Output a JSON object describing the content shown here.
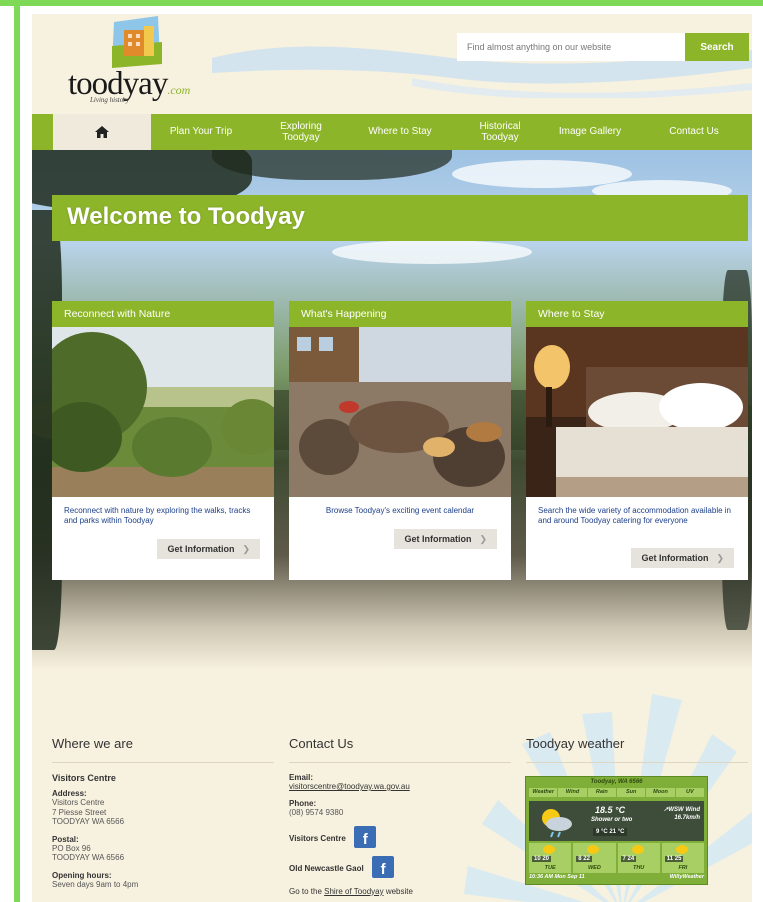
{
  "colors": {
    "brand_green": "#8db52a",
    "page_background": "#f7f1df",
    "frame_green": "#7ed957",
    "card_link_blue": "#1c3f8a",
    "facebook_blue": "#3b6db5"
  },
  "header": {
    "logo_text": "toodyay",
    "logo_suffix": ".com",
    "logo_tagline": "Living history",
    "search_placeholder": "Find almost anything on our website",
    "search_button": "Search"
  },
  "nav": {
    "home_icon": "home-icon",
    "items": [
      {
        "label": "Plan Your Trip"
      },
      {
        "label": "Exploring Toodyay"
      },
      {
        "label": "Where to Stay"
      },
      {
        "label": "Historical Toodyay"
      },
      {
        "label": "Image Gallery"
      },
      {
        "label": "Contact Us"
      }
    ]
  },
  "hero": {
    "title": "Welcome to Toodyay"
  },
  "cards": [
    {
      "title": "Reconnect with Nature",
      "text": "Reconnect with nature by exploring the walks, tracks and parks within Toodyay",
      "button": "Get Information"
    },
    {
      "title": "What's Happening",
      "text": "Browse Toodyay's exciting event calendar",
      "button": "Get Information"
    },
    {
      "title": "Where to Stay",
      "text": "Search the wide variety of accommodation available in and around Toodyay catering for everyone",
      "button": "Get Information"
    }
  ],
  "footer": {
    "where": {
      "heading": "Where we are",
      "centre_name": "Visitors Centre",
      "address_label": "Address:",
      "address_line1": "Visitors Centre",
      "address_line2": "7 Piesse Street",
      "address_line3": "TOODYAY  WA  6566",
      "postal_label": "Postal:",
      "postal_line1": "PO Box 96",
      "postal_line2": "TOODYAY  WA  6566",
      "hours_label": "Opening hours:",
      "hours_value": "Seven days 9am to 4pm"
    },
    "contact": {
      "heading": "Contact Us",
      "email_label": "Email:",
      "email_value": "visitorscentre@toodyay.wa.gov.au",
      "phone_label": "Phone:",
      "phone_value": "(08) 9574 9380",
      "visitors_centre_label": "Visitors Centre",
      "gaol_label": "Old Newcastle Gaol",
      "facebook_glyph": "f",
      "shire_prefix": "Go to the ",
      "shire_link": "Shire of Toodyay",
      "shire_suffix": " website"
    },
    "weather": {
      "heading": "Toodyay weather",
      "location": "Toodyay, WA 6566",
      "tabs": [
        "Weather",
        "Wind",
        "Rain",
        "Sun",
        "Moon",
        "UV"
      ],
      "current_temp": "18.5 °C",
      "description": "Shower or two",
      "range": "9 °C  21 °C",
      "wind_label": "↗WSW Wind",
      "wind_speed": "16.7km/h",
      "days": [
        {
          "range": "10 20",
          "name": "TUE"
        },
        {
          "range": "8 22",
          "name": "WED"
        },
        {
          "range": "7 24",
          "name": "THU"
        },
        {
          "range": "11 25",
          "name": "FRI"
        }
      ],
      "timestamp": "10:36 AM Mon Sep 11",
      "brand": "WillyWeather"
    }
  }
}
